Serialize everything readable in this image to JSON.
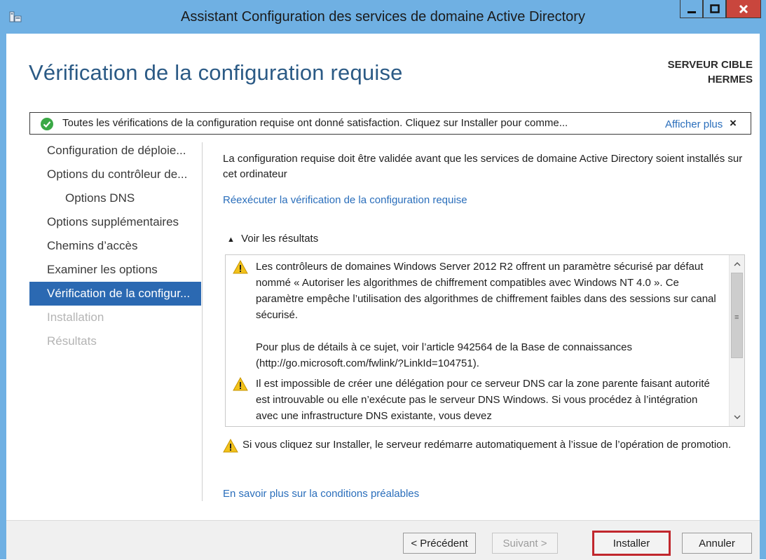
{
  "window": {
    "title": "Assistant Configuration des services de domaine Active Directory",
    "controls": {
      "minimize": "minimize-icon",
      "maximize": "maximize-icon",
      "close": "close-icon"
    }
  },
  "header": {
    "page_title": "Vérification de la configuration requise",
    "target_label": "SERVEUR CIBLE",
    "target_server": "HERMES"
  },
  "notice": {
    "icon": "check-circle-icon",
    "message": "Toutes les vérifications de la configuration requise ont donné satisfaction. Cliquez sur Installer pour comme...",
    "more_link": "Afficher plus",
    "close": "×"
  },
  "nav": {
    "items": [
      {
        "label": "Configuration de déploie...",
        "state": "normal"
      },
      {
        "label": "Options du contrôleur de...",
        "state": "normal"
      },
      {
        "label": "Options DNS",
        "state": "sub"
      },
      {
        "label": "Options supplémentaires",
        "state": "normal"
      },
      {
        "label": "Chemins d’accès",
        "state": "normal"
      },
      {
        "label": "Examiner les options",
        "state": "normal"
      },
      {
        "label": "Vérification de la configur...",
        "state": "active"
      },
      {
        "label": "Installation",
        "state": "disabled"
      },
      {
        "label": "Résultats",
        "state": "disabled"
      }
    ]
  },
  "main": {
    "description": "La configuration requise doit être validée avant que les services de domaine Active Directory soient installés sur cet ordinateur",
    "rerun_link": "Réexécuter la vérification de la configuration requise",
    "results_toggle": "Voir les résultats",
    "results": [
      {
        "icon": "warning-icon",
        "paragraphs": [
          "Les contrôleurs de domaines Windows Server 2012 R2 offrent un paramètre sécurisé par défaut nommé « Autoriser les algorithmes de chiffrement compatibles avec Windows NT 4.0 ». Ce paramètre empêche l’utilisation des algorithmes de chiffrement faibles dans des sessions sur canal sécurisé.",
          "Pour plus de détails à ce sujet, voir l’article 942564 de la Base de connaissances (http://go.microsoft.com/fwlink/?LinkId=104751)."
        ]
      },
      {
        "icon": "warning-icon",
        "paragraphs": [
          "Il est impossible de créer une délégation pour ce serveur DNS car la zone parente faisant autorité est introuvable ou elle n’exécute pas le serveur DNS Windows. Si vous procédez à l’intégration avec une infrastructure DNS existante, vous devez"
        ]
      }
    ],
    "restart_warning": "Si vous cliquez sur Installer, le serveur redémarre automatiquement à l’issue de l’opération de promotion.",
    "learn_more_link": "En savoir plus sur la conditions préalables"
  },
  "footer": {
    "previous": "< Précédent",
    "next": "Suivant >",
    "install": "Installer",
    "cancel": "Annuler"
  },
  "colors": {
    "titlebar": "#6fb0e3",
    "accent": "#2b69b2",
    "link": "#2a6ebb",
    "highlight_border": "#c1272d"
  }
}
